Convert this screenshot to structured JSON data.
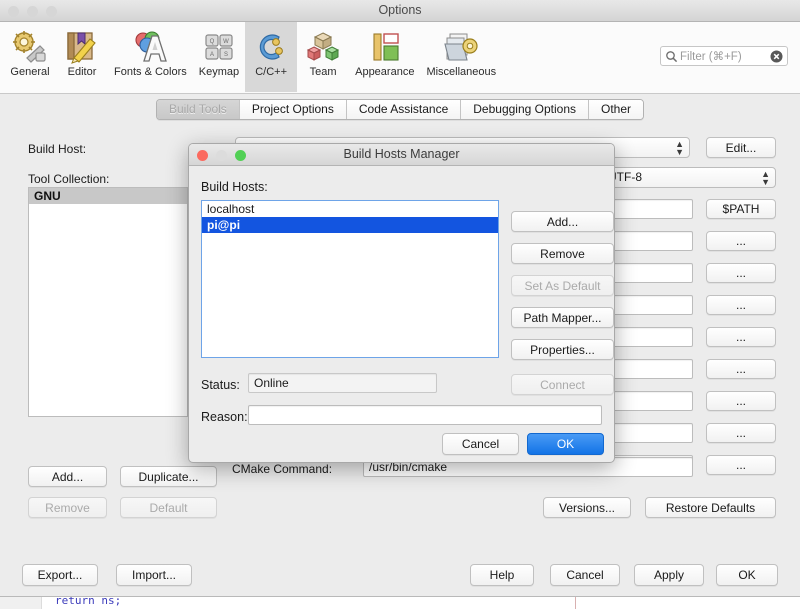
{
  "window": {
    "title": "Options",
    "traffic_lights": [
      "minimize-dot",
      "zoom-dot",
      "close-dot"
    ]
  },
  "toolbar": {
    "items": [
      {
        "label": "General",
        "icon": "general-gear-wrench-icon"
      },
      {
        "label": "Editor",
        "icon": "editor-notebook-pencil-icon"
      },
      {
        "label": "Fonts & Colors",
        "icon": "fonts-colors-icon"
      },
      {
        "label": "Keymap",
        "icon": "keymap-keys-icon"
      },
      {
        "label": "C/C++",
        "icon": "cpp-icon",
        "active": true
      },
      {
        "label": "Team",
        "icon": "team-cubes-icon"
      },
      {
        "label": "Appearance",
        "icon": "appearance-panels-icon"
      },
      {
        "label": "Miscellaneous",
        "icon": "miscellaneous-folder-gear-icon"
      }
    ],
    "filter": {
      "placeholder": "Filter (⌘+F)",
      "value": "",
      "search_icon": "search-icon",
      "clear_icon": "clear-circle-icon"
    }
  },
  "tabs": [
    {
      "label": "Build Tools",
      "active": true
    },
    {
      "label": "Project Options",
      "active": false
    },
    {
      "label": "Code Assistance",
      "active": false
    },
    {
      "label": "Debugging Options",
      "active": false
    },
    {
      "label": "Other",
      "active": false
    }
  ],
  "main": {
    "build_host_label": "Build Host:",
    "build_host_value": "",
    "edit_button": "Edit...",
    "tool_collection_label": "Tool Collection:",
    "encoding_value": "UTF-8",
    "tool_collection_list": [
      {
        "label": "GNU",
        "selected": true
      }
    ],
    "path_button": "$PATH",
    "ellipsis_button": "...",
    "ellipsis_button_count": 8,
    "collection_buttons": [
      {
        "label": "Add...",
        "disabled": false
      },
      {
        "label": "Duplicate...",
        "disabled": false
      },
      {
        "label": "Remove",
        "disabled": true
      },
      {
        "label": "Default",
        "disabled": true
      }
    ],
    "cmake_label": "CMake Command:",
    "cmake_value": "/usr/bin/cmake",
    "versions_button": "Versions...",
    "restore_defaults_button": "Restore Defaults"
  },
  "footer": {
    "export_button": "Export...",
    "import_button": "Import...",
    "help_button": "Help",
    "cancel_button": "Cancel",
    "apply_button": "Apply",
    "ok_button": "OK"
  },
  "dialog": {
    "title": "Build Hosts Manager",
    "hosts_label": "Build Hosts:",
    "hosts": [
      {
        "name": "localhost",
        "selected": false
      },
      {
        "name": "pi@pi",
        "selected": true
      }
    ],
    "side_buttons": [
      {
        "label": "Add...",
        "disabled": false
      },
      {
        "label": "Remove",
        "disabled": false
      },
      {
        "label": "Set As Default",
        "disabled": true
      },
      {
        "label": "Path Mapper...",
        "disabled": false
      },
      {
        "label": "Properties...",
        "disabled": false
      },
      {
        "label": "Connect",
        "disabled": true
      }
    ],
    "status_label": "Status:",
    "status_value": "Online",
    "reason_label": "Reason:",
    "reason_value": "",
    "cancel_button": "Cancel",
    "ok_button": "OK"
  },
  "background_document": {
    "code_snippet": "return ns;"
  },
  "colors": {
    "accent_blue": "#1273e6",
    "selection_blue": "#1355e0",
    "selection_grey": "#c8c8c8",
    "window_bg": "#ececec"
  }
}
